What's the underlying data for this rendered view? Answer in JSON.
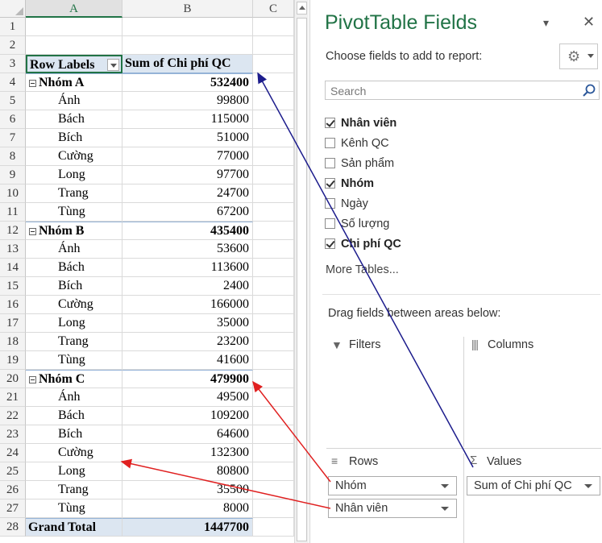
{
  "sheet": {
    "columns": [
      "A",
      "B",
      "C"
    ],
    "header": {
      "row_labels": "Row Labels",
      "sum_label": "Sum of Chi phí QC"
    },
    "groups": [
      {
        "name": "Nhóm A",
        "total": "532400",
        "items": [
          [
            "Ánh",
            "99800"
          ],
          [
            "Bách",
            "115000"
          ],
          [
            "Bích",
            "51000"
          ],
          [
            "Cường",
            "77000"
          ],
          [
            "Long",
            "97700"
          ],
          [
            "Trang",
            "24700"
          ],
          [
            "Tùng",
            "67200"
          ]
        ]
      },
      {
        "name": "Nhóm B",
        "total": "435400",
        "items": [
          [
            "Ánh",
            "53600"
          ],
          [
            "Bách",
            "113600"
          ],
          [
            "Bích",
            "2400"
          ],
          [
            "Cường",
            "166000"
          ],
          [
            "Long",
            "35000"
          ],
          [
            "Trang",
            "23200"
          ],
          [
            "Tùng",
            "41600"
          ]
        ]
      },
      {
        "name": "Nhóm C",
        "total": "479900",
        "items": [
          [
            "Ánh",
            "49500"
          ],
          [
            "Bách",
            "109200"
          ],
          [
            "Bích",
            "64600"
          ],
          [
            "Cường",
            "132300"
          ],
          [
            "Long",
            "80800"
          ],
          [
            "Trang",
            "35500"
          ],
          [
            "Tùng",
            "8000"
          ]
        ]
      }
    ],
    "grand_total_label": "Grand Total",
    "grand_total": "1447700"
  },
  "pane": {
    "title": "PivotTable Fields",
    "choose_label": "Choose fields to add to report:",
    "search_placeholder": "Search",
    "fields": [
      {
        "label": "Nhân viên",
        "checked": true
      },
      {
        "label": "Kênh QC",
        "checked": false
      },
      {
        "label": "Sản phẩm",
        "checked": false
      },
      {
        "label": "Nhóm",
        "checked": true
      },
      {
        "label": "Ngày",
        "checked": false
      },
      {
        "label": "Số lượng",
        "checked": false
      },
      {
        "label": "Chi phí QC",
        "checked": true
      }
    ],
    "more_tables": "More Tables...",
    "drag_label": "Drag fields between areas below:",
    "areas": {
      "filters": "Filters",
      "columns": "Columns",
      "rows": "Rows",
      "values": "Values"
    },
    "rows_items": [
      "Nhóm",
      "Nhân viên"
    ],
    "values_items": [
      "Sum of Chi phí QC"
    ]
  },
  "colors": {
    "accent": "#217346",
    "pivot_header": "#dce6f1",
    "arrow_blue": "#1c1c8c",
    "arrow_red": "#e02020"
  }
}
